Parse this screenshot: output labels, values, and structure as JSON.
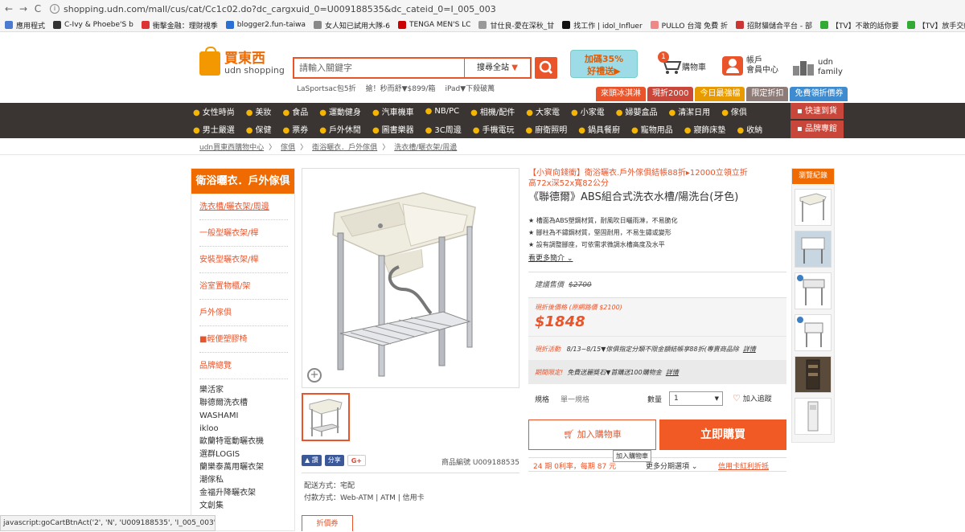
{
  "browser": {
    "url": "shopping.udn.com/mall/cus/cat/Cc1c02.do?dc_cargxuid_0=U009188535&dc_cateid_0=I_005_003",
    "bookmarks": [
      {
        "label": "應用程式",
        "color": "#4a7bd0"
      },
      {
        "label": "C-Ivy & Phoebe'S b",
        "color": "#333"
      },
      {
        "label": "衝擊金融：理財視季",
        "color": "#d33"
      },
      {
        "label": "blogger2.fun-taiwa",
        "color": "#2a6fd6"
      },
      {
        "label": "女人知已試用大隊-6",
        "color": "#888"
      },
      {
        "label": "TENGA MEN'S LC",
        "color": "#c00"
      },
      {
        "label": "甘仕良-愛在深秋_甘",
        "color": "#999"
      },
      {
        "label": "找工作 | idol_Influer",
        "color": "#111"
      },
      {
        "label": "PULLO 台灣 免費 折",
        "color": "#e88"
      },
      {
        "label": "招財貓儲合平台 - 部",
        "color": "#c33"
      },
      {
        "label": "【TV】不敢的話你要",
        "color": "#3a3"
      },
      {
        "label": "【TV】放手交給她",
        "color": "#3a3"
      }
    ]
  },
  "header": {
    "logo_cn": "買東西",
    "logo_en": "udn shopping",
    "search_placeholder": "請輸入關鍵字",
    "search_scope": "搜尋全站",
    "hot_keywords": [
      "LaSportsac包5折",
      "搶！秒而舒▼$899/箱",
      "iPad▼下殺破萬"
    ],
    "promo_line1": "加碼35%",
    "promo_line2": "好禮送▶",
    "cart_label": "購物車",
    "cart_count": "1",
    "member_line1": "帳戶",
    "member_line2": "會員中心",
    "family_line1": "udn",
    "family_line2": "family",
    "tabs": [
      {
        "label": "來頭冰淇淋",
        "color": "#e9542a"
      },
      {
        "label": "現折2000",
        "color": "#c9473a"
      },
      {
        "label": "今日最強檔",
        "color": "#e89b00"
      },
      {
        "label": "限定折扣",
        "color": "#8c7b76"
      },
      {
        "label": "免費領折價券",
        "color": "#3e8bd0"
      }
    ]
  },
  "categories": {
    "row1": [
      "女性時尚",
      "美妝",
      "食品",
      "運動健身",
      "汽車機車",
      "NB/PC",
      "相機/配件",
      "大家電",
      "小家電",
      "婦嬰盒品",
      "清潔日用",
      "傢俱"
    ],
    "row2": [
      "男士嚴選",
      "保健",
      "票券",
      "戶外休閒",
      "圖書樂器",
      "3C周邊",
      "手機電玩",
      "廚衛照明",
      "鍋具餐廚",
      "寵物用品",
      "寢飾床墊",
      "收納"
    ],
    "quick": "快速到貨",
    "brand": "品牌專館"
  },
  "breadcrumb": [
    "udn買東西購物中心",
    "傢俱",
    "衛浴曬衣．戶外傢俱",
    "洗衣槽/曬衣架/周邊"
  ],
  "sidebar": {
    "title": "衛浴曬衣．戶外傢俱",
    "items": [
      "洗衣槽/曬衣架/周邊",
      "一般型曬衣架/桿",
      "安裝型曬衣架/桿",
      "浴室置物櫃/架",
      "戶外傢俱",
      "■輕便塑膠椅",
      "品牌總覽"
    ],
    "brands": [
      "樂活家",
      "聯德爾洗衣槽",
      "WASHAMI",
      "ikloo",
      "歐蘭特電動曬衣機",
      "選群LOGIS",
      "蘭樂泰萬用曬衣架",
      "潮傢私",
      "金福升降曬衣架",
      "文創集"
    ]
  },
  "product": {
    "promo": "【小資向錢衝】衛浴曬衣.戶外傢俱結帳88折▸12000立領立折",
    "size": "高72x深52x寬82公分",
    "title": "《聯德爾》ABS組合式洗衣水槽/陽洗台(牙色)",
    "features": [
      "★ 槽面為ABS塑鋼材質，耐風吹日曬雨淋，不易脆化",
      "★ 腳柱為不鏽鋼材質，堅固耐用，不易生鏽或變形",
      "★ 設有調整腳座，可依需求微調水槽高度及水平"
    ],
    "more": "看更多簡介",
    "list_price_label": "建議售價",
    "list_price": "$2700",
    "sale_label": "現折後價格 (原網路價 $2100)",
    "sale_price": "$1848",
    "activity_label": "現折活動",
    "activity_text": "8/13~8/15▼傢俱指定分類不限金額結帳享88折(專賣商品除",
    "activity_link": "詳情",
    "limit_label": "期間限定!",
    "limit_text": "免費送麗獎石▼首購送100購物金",
    "limit_link": "詳情",
    "spec_label": "規格",
    "spec_value": "單一規格",
    "qty_label": "數量",
    "qty_value": "1",
    "wish_label": "加入追蹤",
    "cart_button": "加入購物車",
    "buy_button": "立即購買",
    "tooltip": "加入購物車",
    "installment": "24 期 0利率，每期 87 元",
    "installment_more": "更多分期選項",
    "credit_link": "信用卡紅利折抵",
    "sku_label": "商品編號 U009188535",
    "ship_method": "配送方式：宅配",
    "pay_method": "付款方式：Web-ATM | ATM | 信用卡",
    "coupon_tab": "折價券"
  },
  "share": {
    "like": "讚",
    "share": "分享",
    "gplus": "G+"
  },
  "recent": {
    "title": "瀏覽紀錄"
  },
  "status_bar": "javascript:goCartBtnAct('2', 'N', 'U009188535', 'I_005_003', false)"
}
